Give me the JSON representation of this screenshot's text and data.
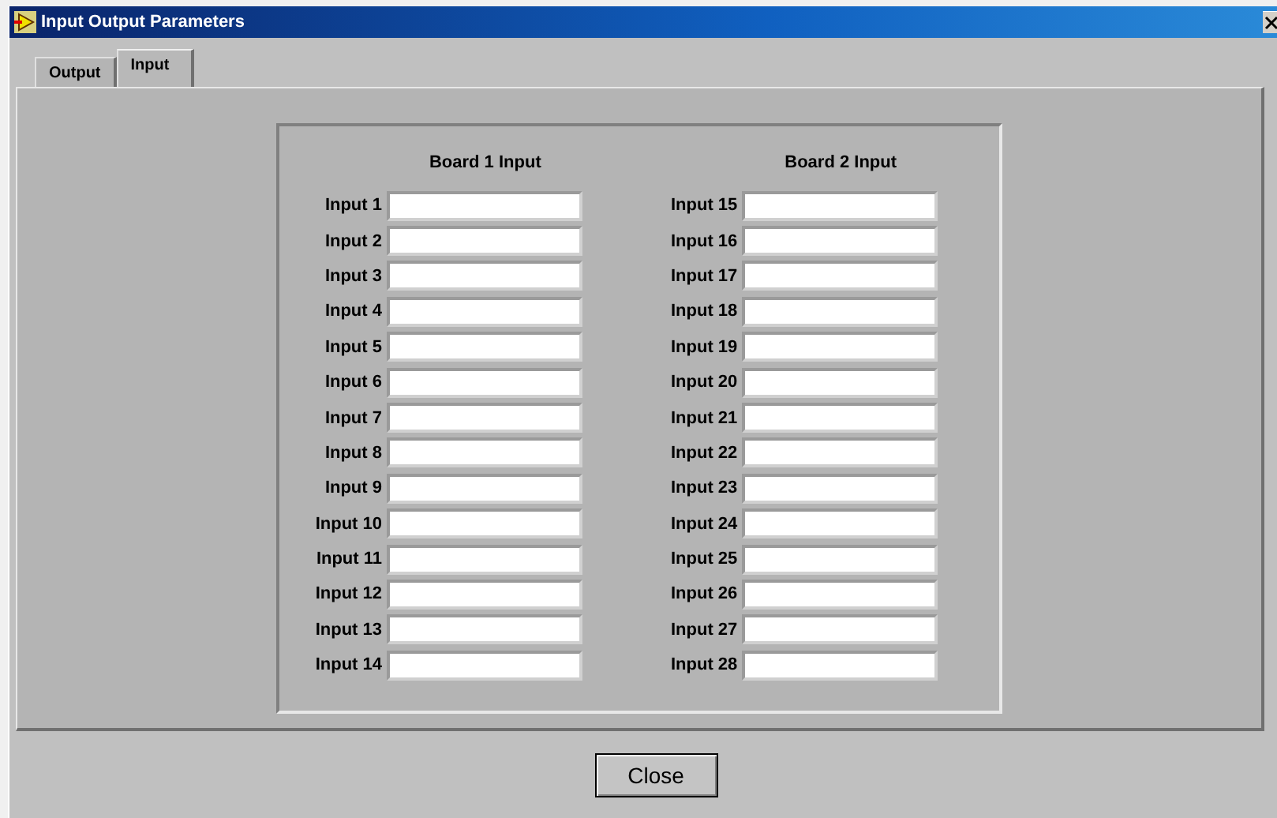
{
  "window": {
    "title": "Input Output Parameters"
  },
  "tabs": [
    {
      "label": "Output",
      "selected": false
    },
    {
      "label": "Input",
      "selected": true
    }
  ],
  "boards": [
    {
      "heading": "Board 1 Input",
      "inputs": [
        {
          "label": "Input 1"
        },
        {
          "label": "Input 2"
        },
        {
          "label": "Input 3"
        },
        {
          "label": "Input 4"
        },
        {
          "label": "Input 5"
        },
        {
          "label": "Input 6"
        },
        {
          "label": "Input 7"
        },
        {
          "label": "Input 8"
        },
        {
          "label": "Input 9"
        },
        {
          "label": "Input 10"
        },
        {
          "label": "Input 11"
        },
        {
          "label": "Input 12"
        },
        {
          "label": "Input 13"
        },
        {
          "label": "Input 14"
        }
      ]
    },
    {
      "heading": "Board 2 Input",
      "inputs": [
        {
          "label": "Input 15"
        },
        {
          "label": "Input 16"
        },
        {
          "label": "Input 17"
        },
        {
          "label": "Input 18"
        },
        {
          "label": "Input 19"
        },
        {
          "label": "Input 20"
        },
        {
          "label": "Input 21"
        },
        {
          "label": "Input 22"
        },
        {
          "label": "Input 23"
        },
        {
          "label": "Input 24"
        },
        {
          "label": "Input 25"
        },
        {
          "label": "Input 26"
        },
        {
          "label": "Input 27"
        },
        {
          "label": "Input 28"
        }
      ]
    }
  ],
  "buttons": [
    {
      "label": "Close"
    }
  ]
}
